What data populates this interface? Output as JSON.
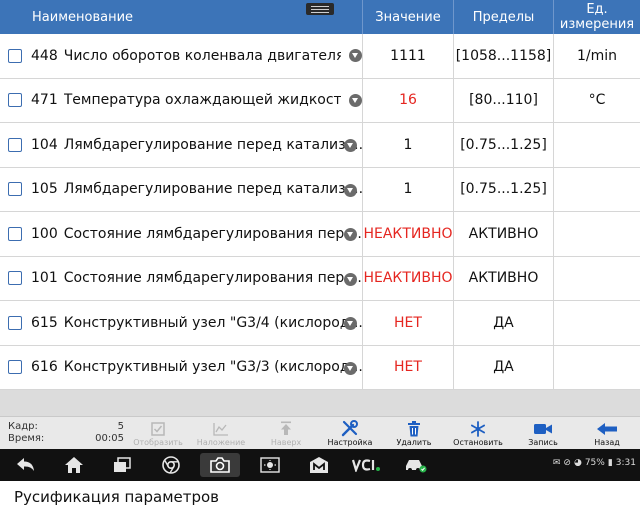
{
  "table": {
    "headers": {
      "name": "Наименование",
      "value": "Значение",
      "limits": "Пределы",
      "units": "Ед. измерения"
    },
    "rows": [
      {
        "id": "448",
        "name": "Число оборотов коленвала двигателя",
        "value": "1111",
        "value_color": "#111111",
        "limits": "[1058...1158]",
        "unit": "1/min"
      },
      {
        "id": "471",
        "name": "Температура охлаждающей жидкости",
        "value": "16",
        "value_color": "#e52620",
        "limits": "[80...110]",
        "unit": "°C"
      },
      {
        "id": "104",
        "name": "Лямбдарегулирование перед катализа...",
        "value": "1",
        "value_color": "#111111",
        "limits": "[0.75...1.25]",
        "unit": ""
      },
      {
        "id": "105",
        "name": "Лямбдарегулирование перед катализа...",
        "value": "1",
        "value_color": "#111111",
        "limits": "[0.75...1.25]",
        "unit": ""
      },
      {
        "id": "100",
        "name": "Состояние лямбдарегулирования пере...",
        "value": "НЕАКТИВНО",
        "value_color": "#e52620",
        "limits": "АКТИВНО",
        "unit": ""
      },
      {
        "id": "101",
        "name": "Состояние лямбдарегулирования пере...",
        "value": "НЕАКТИВНО",
        "value_color": "#e52620",
        "limits": "АКТИВНО",
        "unit": ""
      },
      {
        "id": "615",
        "name": "Конструктивный узел \"G3/4 (кислород...",
        "value": "НЕТ",
        "value_color": "#e52620",
        "limits": "ДА",
        "unit": ""
      },
      {
        "id": "616",
        "name": "Конструктивный узел \"G3/3 (кислород...",
        "value": "НЕТ",
        "value_color": "#e52620",
        "limits": "ДА",
        "unit": ""
      }
    ]
  },
  "info": {
    "frame_label": "Кадр:",
    "frame_value": "5",
    "time_label": "Время:",
    "time_value": "00:05"
  },
  "toolbar": {
    "show": "Отобразить",
    "overlay": "Наложение",
    "up": "Наверх",
    "settings": "Настройка",
    "delete": "Удалить",
    "stop": "Остановить",
    "record": "Запись",
    "back": "Назад"
  },
  "status": {
    "battery": "75%",
    "time": "3:31"
  },
  "caption": "Русификация параметров",
  "colors": {
    "header_bg": "#3c74b8",
    "value_alert": "#e52620",
    "accent_icon": "#1e5fc2"
  }
}
